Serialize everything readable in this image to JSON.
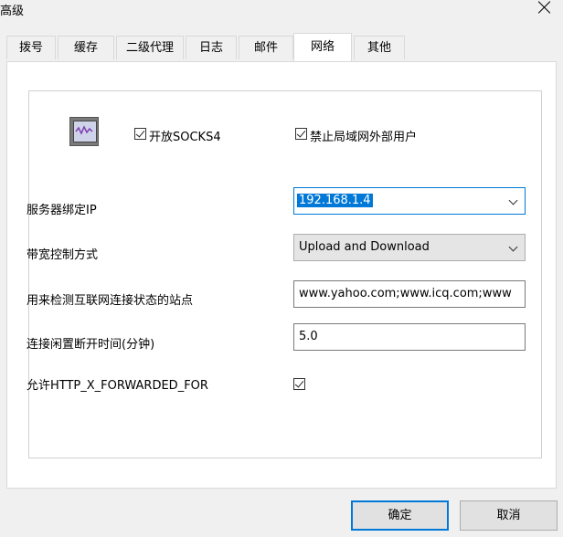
{
  "window": {
    "title": "高级"
  },
  "tabs": [
    {
      "label": "拨号"
    },
    {
      "label": "缓存"
    },
    {
      "label": "二级代理"
    },
    {
      "label": "日志"
    },
    {
      "label": "邮件"
    },
    {
      "label": "网络",
      "active": true
    },
    {
      "label": "其他"
    }
  ],
  "options": {
    "socks4_label": "开放SOCKS4",
    "socks4_checked": true,
    "block_external_label": "禁止局域网外部用户",
    "block_external_checked": true
  },
  "fields": {
    "bind_ip": {
      "label": "服务器绑定IP",
      "value": "192.168.1.4"
    },
    "bandwidth": {
      "label": "带宽控制方式",
      "value": "Upload and Download"
    },
    "check_sites": {
      "label": "用来检测互联网连接状态的站点",
      "value": "www.yahoo.com;www.icq.com;www"
    },
    "idle_timeout": {
      "label": "连接闲置断开时间(分钟)",
      "value": "5.0"
    },
    "forwarded_for": {
      "label": "允许HTTP_X_FORWARDED_FOR",
      "checked": true
    }
  },
  "buttons": {
    "ok": "确定",
    "cancel": "取消"
  },
  "colors": {
    "accent": "#0078d7",
    "window_bg": "#f0f0f0"
  },
  "icons": {
    "close": "close-icon",
    "app": "monitor-icon",
    "dropdown": "chevron-down-icon"
  }
}
